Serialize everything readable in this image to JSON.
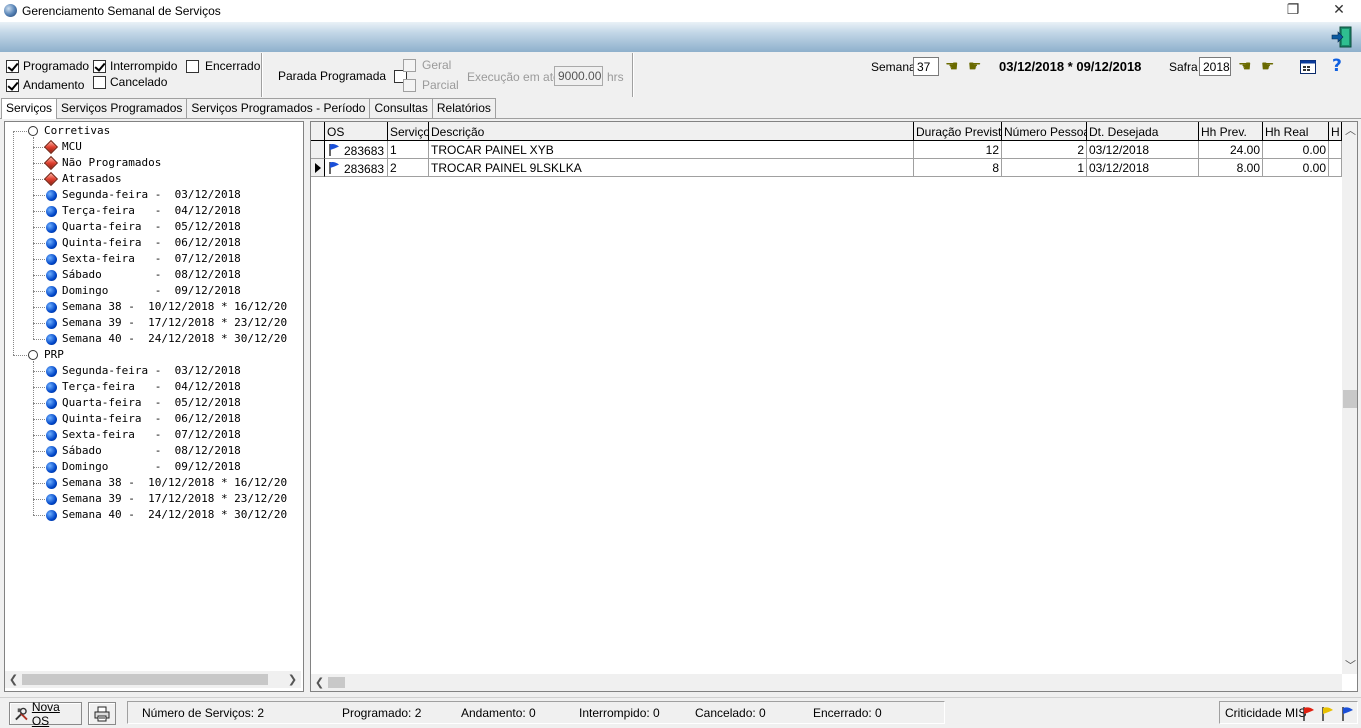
{
  "window": {
    "title": "Gerenciamento Semanal de Serviços",
    "restore_glyph": "❐",
    "close_glyph": "✕"
  },
  "filters": {
    "programado": {
      "label": "Programado",
      "checked": true
    },
    "interrompido": {
      "label": "Interrompido",
      "checked": true
    },
    "encerrado": {
      "label": "Encerrado",
      "checked": false
    },
    "andamento": {
      "label": "Andamento",
      "checked": true
    },
    "cancelado": {
      "label": "Cancelado",
      "checked": false
    },
    "parada_programada": {
      "label": "Parada Programada",
      "checked": false
    },
    "geral": {
      "label": "Geral",
      "checked": false
    },
    "parcial": {
      "label": "Parcial",
      "checked": false
    },
    "execucao_label": "Execução em até",
    "execucao_value": "9000.00",
    "execucao_unit": "hrs"
  },
  "week": {
    "label": "Semana",
    "value": "37",
    "range": "03/12/2018 * 09/12/2018",
    "safra_label": "Safra",
    "safra_value": "2018"
  },
  "icons": {
    "prev": "☚",
    "next": "☛",
    "help": "?"
  },
  "tabs": [
    "Serviços",
    "Serviços Programados",
    "Serviços Programados - Período",
    "Consultas",
    "Relatórios"
  ],
  "tree": [
    {
      "text": "Corretivas",
      "level": 0,
      "icon": "open"
    },
    {
      "text": "MCU",
      "level": 1,
      "icon": "red"
    },
    {
      "text": "Não Programados",
      "level": 1,
      "icon": "red"
    },
    {
      "text": "Atrasados",
      "level": 1,
      "icon": "red"
    },
    {
      "text": "Segunda-feira -  03/12/2018",
      "level": 1,
      "icon": "blue"
    },
    {
      "text": "Terça-feira   -  04/12/2018",
      "level": 1,
      "icon": "blue"
    },
    {
      "text": "Quarta-feira  -  05/12/2018",
      "level": 1,
      "icon": "blue"
    },
    {
      "text": "Quinta-feira  -  06/12/2018",
      "level": 1,
      "icon": "blue"
    },
    {
      "text": "Sexta-feira   -  07/12/2018",
      "level": 1,
      "icon": "blue"
    },
    {
      "text": "Sábado        -  08/12/2018",
      "level": 1,
      "icon": "blue"
    },
    {
      "text": "Domingo       -  09/12/2018",
      "level": 1,
      "icon": "blue"
    },
    {
      "text": "Semana 38 -  10/12/2018 * 16/12/20",
      "level": 1,
      "icon": "blue"
    },
    {
      "text": "Semana 39 -  17/12/2018 * 23/12/20",
      "level": 1,
      "icon": "blue"
    },
    {
      "text": "Semana 40 -  24/12/2018 * 30/12/20",
      "level": 1,
      "icon": "blue"
    },
    {
      "text": "PRP",
      "level": 0,
      "icon": "open"
    },
    {
      "text": "Segunda-feira -  03/12/2018",
      "level": 1,
      "icon": "blue"
    },
    {
      "text": "Terça-feira   -  04/12/2018",
      "level": 1,
      "icon": "blue"
    },
    {
      "text": "Quarta-feira  -  05/12/2018",
      "level": 1,
      "icon": "blue"
    },
    {
      "text": "Quinta-feira  -  06/12/2018",
      "level": 1,
      "icon": "blue"
    },
    {
      "text": "Sexta-feira   -  07/12/2018",
      "level": 1,
      "icon": "blue"
    },
    {
      "text": "Sábado        -  08/12/2018",
      "level": 1,
      "icon": "blue"
    },
    {
      "text": "Domingo       -  09/12/2018",
      "level": 1,
      "icon": "blue"
    },
    {
      "text": "Semana 38 -  10/12/2018 * 16/12/20",
      "level": 1,
      "icon": "blue"
    },
    {
      "text": "Semana 39 -  17/12/2018 * 23/12/20",
      "level": 1,
      "icon": "blue"
    },
    {
      "text": "Semana 40 -  24/12/2018 * 30/12/20",
      "level": 1,
      "icon": "blue"
    }
  ],
  "grid": {
    "columns": [
      "OS",
      "Serviço",
      "Descrição",
      "Duração Prevista",
      "Número Pessoas",
      "Dt. Desejada",
      "Hh Prev.",
      "Hh Real",
      "H"
    ],
    "rows": [
      {
        "os": "283683",
        "servico": "1",
        "descricao": "TROCAR PAINEL XYB",
        "duracao": "12",
        "pessoas": "2",
        "dt": "03/12/2018",
        "hh_prev": "24.00",
        "hh_real": "0.00",
        "current": false
      },
      {
        "os": "283683",
        "servico": "2",
        "descricao": "TROCAR PAINEL 9LSKLKA",
        "duracao": "8",
        "pessoas": "1",
        "dt": "03/12/2018",
        "hh_prev": "8.00",
        "hh_real": "0.00",
        "current": true
      }
    ]
  },
  "statusbar": {
    "nova_os": "Nova OS",
    "numero_servicos": "Número de Serviços: 2",
    "programado": "Programado: 2",
    "andamento": "Andamento: 0",
    "interrompido": "Interrompido: 0",
    "cancelado": "Cancelado: 0",
    "encerrado": "Encerrado: 0",
    "criticidade": "Criticidade MIS"
  },
  "colors": {
    "flag_blue": "#1a4fd8",
    "flag_red": "#e02010",
    "flag_yellow": "#e8c000",
    "accent_green": "#1a8a6a",
    "help_blue": "#1060e0"
  }
}
